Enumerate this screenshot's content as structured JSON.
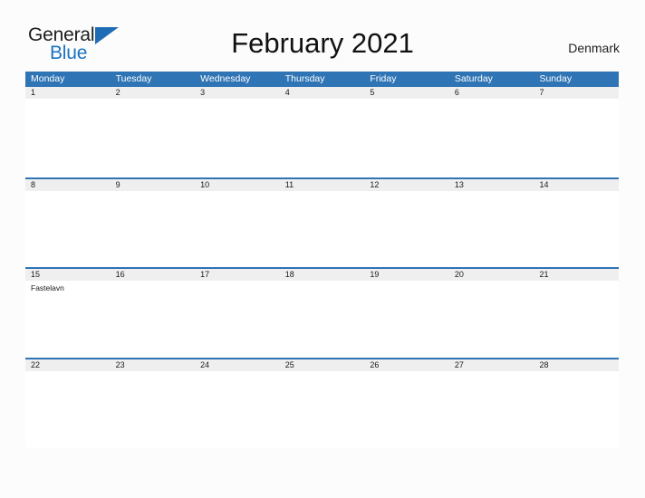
{
  "brand": {
    "name_part1": "General",
    "name_part2": "Blue",
    "colors": {
      "general_text": "#1c1c1c",
      "blue_text": "#1a73c0",
      "flag": "#1f6cb5"
    }
  },
  "header": {
    "title": "February 2021",
    "country": "Denmark"
  },
  "theme": {
    "header_blue": "#2f74b5",
    "date_strip_gray": "#efefef",
    "page_background": "#fcfcfd",
    "cell_white": "#ffffff"
  },
  "calendar": {
    "weekdays": [
      "Monday",
      "Tuesday",
      "Wednesday",
      "Thursday",
      "Friday",
      "Saturday",
      "Sunday"
    ],
    "weeks": [
      {
        "days": [
          {
            "date": "1",
            "event": ""
          },
          {
            "date": "2",
            "event": ""
          },
          {
            "date": "3",
            "event": ""
          },
          {
            "date": "4",
            "event": ""
          },
          {
            "date": "5",
            "event": ""
          },
          {
            "date": "6",
            "event": ""
          },
          {
            "date": "7",
            "event": ""
          }
        ]
      },
      {
        "days": [
          {
            "date": "8",
            "event": ""
          },
          {
            "date": "9",
            "event": ""
          },
          {
            "date": "10",
            "event": ""
          },
          {
            "date": "11",
            "event": ""
          },
          {
            "date": "12",
            "event": ""
          },
          {
            "date": "13",
            "event": ""
          },
          {
            "date": "14",
            "event": ""
          }
        ]
      },
      {
        "days": [
          {
            "date": "15",
            "event": "Fastelavn"
          },
          {
            "date": "16",
            "event": ""
          },
          {
            "date": "17",
            "event": ""
          },
          {
            "date": "18",
            "event": ""
          },
          {
            "date": "19",
            "event": ""
          },
          {
            "date": "20",
            "event": ""
          },
          {
            "date": "21",
            "event": ""
          }
        ]
      },
      {
        "days": [
          {
            "date": "22",
            "event": ""
          },
          {
            "date": "23",
            "event": ""
          },
          {
            "date": "24",
            "event": ""
          },
          {
            "date": "25",
            "event": ""
          },
          {
            "date": "26",
            "event": ""
          },
          {
            "date": "27",
            "event": ""
          },
          {
            "date": "28",
            "event": ""
          }
        ]
      }
    ]
  }
}
